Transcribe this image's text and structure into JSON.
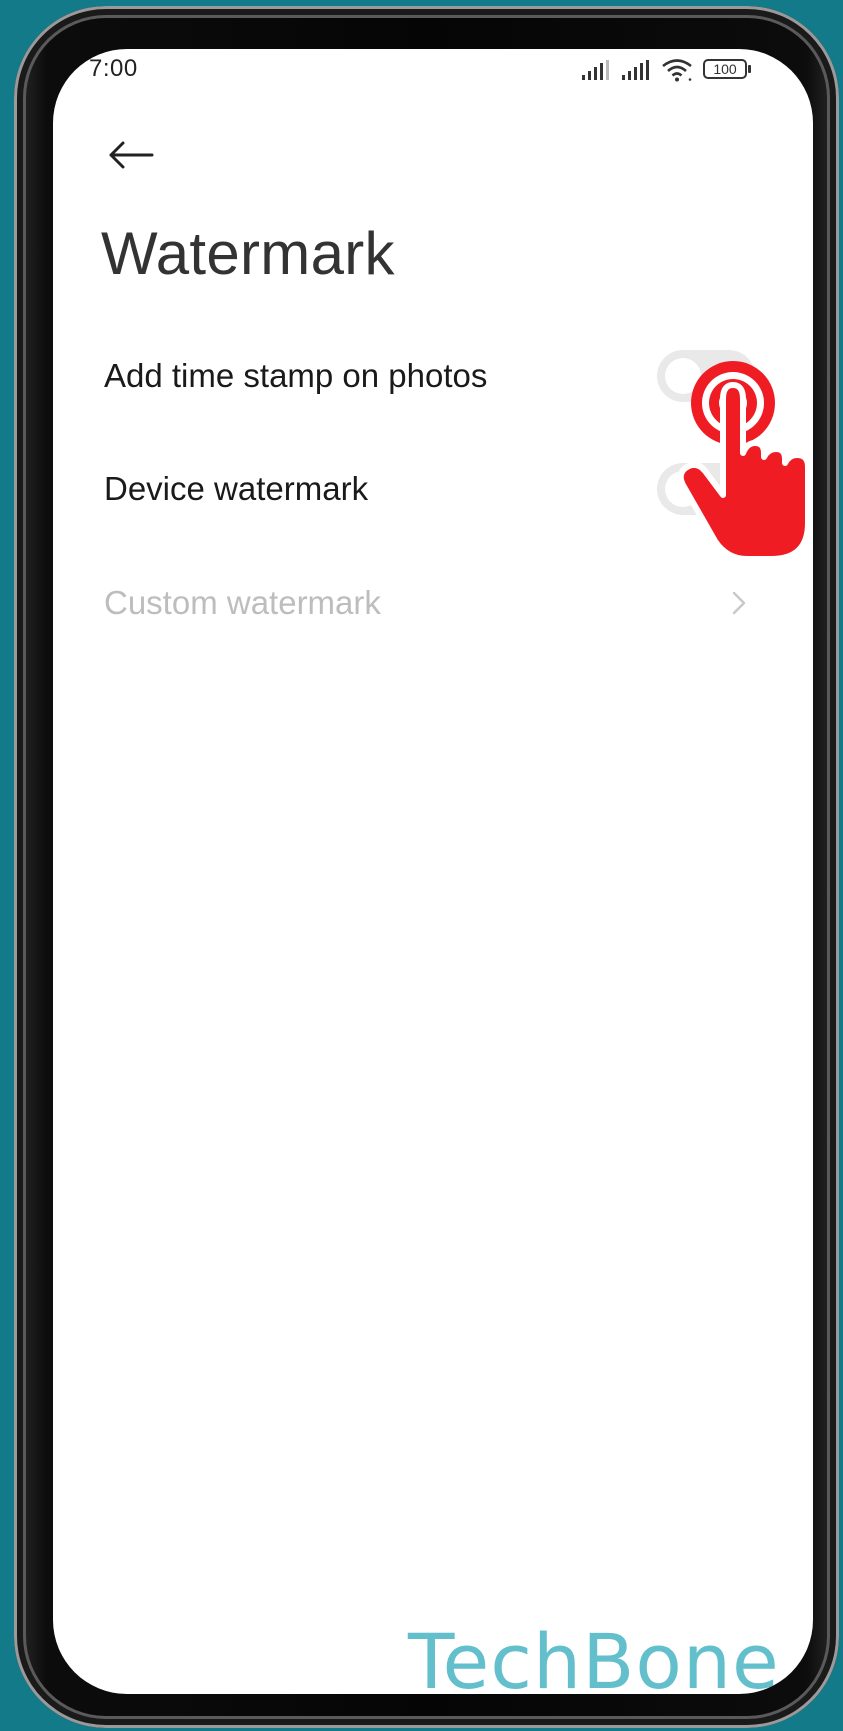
{
  "status_bar": {
    "time": "7:00",
    "battery": "100"
  },
  "header": {
    "title": "Watermark"
  },
  "settings": [
    {
      "label": "Add time stamp on photos",
      "type": "toggle",
      "on": false
    },
    {
      "label": "Device watermark",
      "type": "toggle",
      "on": false
    },
    {
      "label": "Custom watermark",
      "type": "link",
      "disabled": true
    }
  ],
  "branding": {
    "logo_text": "TechBone"
  },
  "colors": {
    "background": "#137a8a",
    "screen": "#ffffff",
    "tap_indicator": "#ef1c24",
    "logo": "#62bfcb"
  },
  "icons": {
    "back": "back-arrow-icon",
    "chevron": "chevron-right-icon",
    "tap": "tap-hand-icon"
  }
}
